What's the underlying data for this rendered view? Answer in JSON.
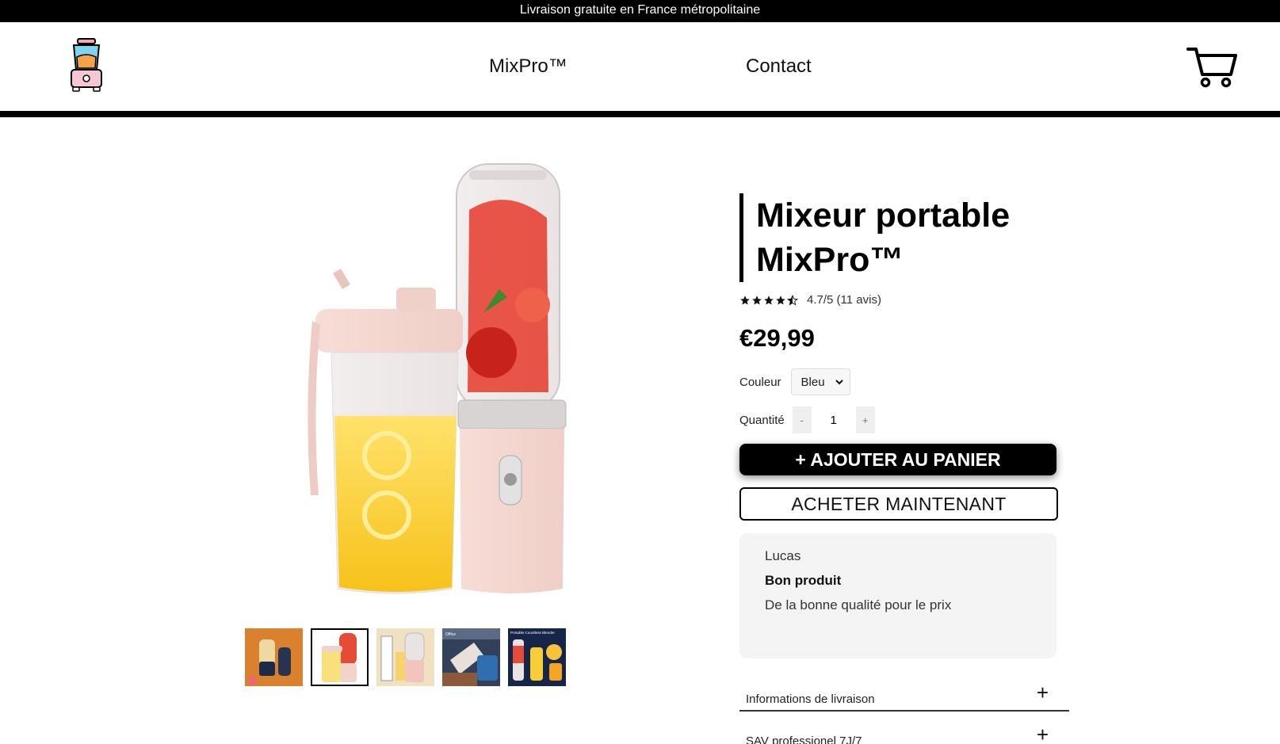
{
  "announcement": "Livraison gratuite en France métropolitaine",
  "nav": {
    "links": [
      "MixPro™",
      "Contact"
    ]
  },
  "product": {
    "title": "Mixeur portable MixPro™",
    "rating_text": "4.7/5 (11 avis)",
    "rating": 4.7,
    "rating_max": 5,
    "price": "€29,99",
    "color_label": "Couleur",
    "color_value": "Bleu",
    "qty_label": "Quantité",
    "qty_minus": "-",
    "qty_value": "1",
    "qty_plus": "+",
    "add_to_cart": "+ AJOUTER AU PANIER",
    "buy_now": "ACHETER MAINTENANT"
  },
  "thumbnails": {
    "count": 5,
    "active_index": 1,
    "thumb5_caption": "Portable Countless Blender",
    "thumb4_caption": "Office"
  },
  "review": {
    "author": "Lucas",
    "headline": "Bon produit",
    "body": "De la bonne qualité pour le prix"
  },
  "accordion": [
    {
      "label": "Informations de livraison",
      "icon": "+"
    },
    {
      "label": "SAV professionel 7J/7",
      "icon": "+"
    }
  ],
  "colors": {
    "bar": "#000000",
    "accent_button": "#000000",
    "review_bg": "#f4f4f4"
  }
}
